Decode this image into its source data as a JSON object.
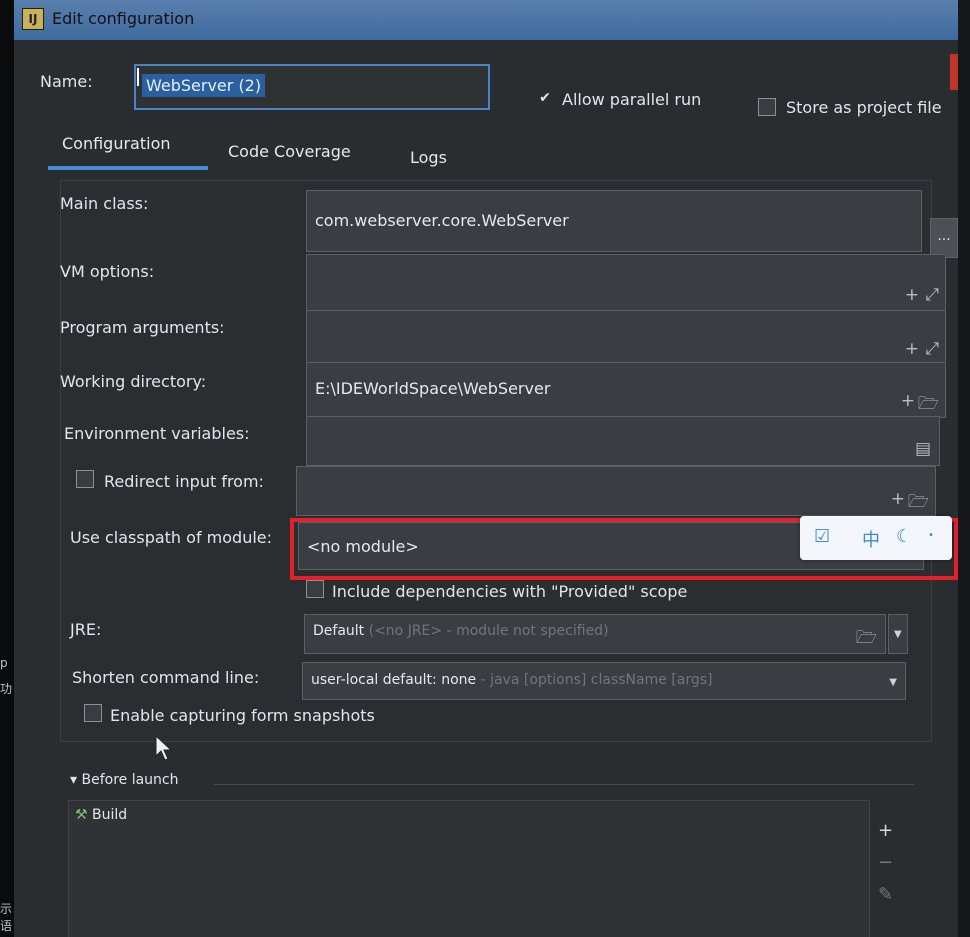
{
  "window": {
    "title": "Edit configuration"
  },
  "side_glyphs": [
    "p",
    "功",
    "示语"
  ],
  "header": {
    "name_label": "Name:",
    "name_value": "WebServer (2)",
    "allow_parallel_label": "Allow parallel run",
    "allow_parallel_checked": true,
    "store_project_label": "Store as project file",
    "store_project_checked": false
  },
  "tabs": [
    "Configuration",
    "Code Coverage",
    "Logs"
  ],
  "active_tab": "Configuration",
  "form": {
    "main_class_label": "Main class:",
    "main_class_value": "com.webserver.core.WebServer",
    "main_class_button": "...",
    "vm_options_label": "VM options:",
    "vm_options_value": "",
    "program_args_label": "Program arguments:",
    "program_args_value": "",
    "working_dir_label": "Working directory:",
    "working_dir_value": "E:\\IDEWorldSpace\\WebServer",
    "env_vars_label": "Environment variables:",
    "env_vars_value": "",
    "redirect_input_label": "Redirect input from:",
    "redirect_input_checked": false,
    "redirect_input_value": "",
    "classpath_module_label": "Use classpath of module:",
    "classpath_module_value": "<no module>",
    "include_deps_label": "Include dependencies with \"Provided\" scope",
    "include_deps_checked": false,
    "jre_label": "JRE:",
    "jre_value_main": "Default",
    "jre_value_detail": "(<no JRE> - module not specified)",
    "shorten_cmd_label": "Shorten command line:",
    "shorten_cmd_value_main": "user-local default: none",
    "shorten_cmd_value_detail": "- java [options] className [args]",
    "capture_snapshots_label": "Enable capturing form snapshots",
    "capture_snapshots_checked": false
  },
  "before_launch": {
    "label": "Before launch",
    "items": [
      "Build"
    ]
  },
  "icons": {
    "plus": "+",
    "expand": "⤢",
    "folder": "🗁",
    "doc": "▤",
    "dropdown": "▼"
  },
  "ime_bar": {
    "lang": "中"
  },
  "colors": {
    "highlight": "#e1222a",
    "accent": "#4a8ad6",
    "bg": "#2a2d30"
  }
}
